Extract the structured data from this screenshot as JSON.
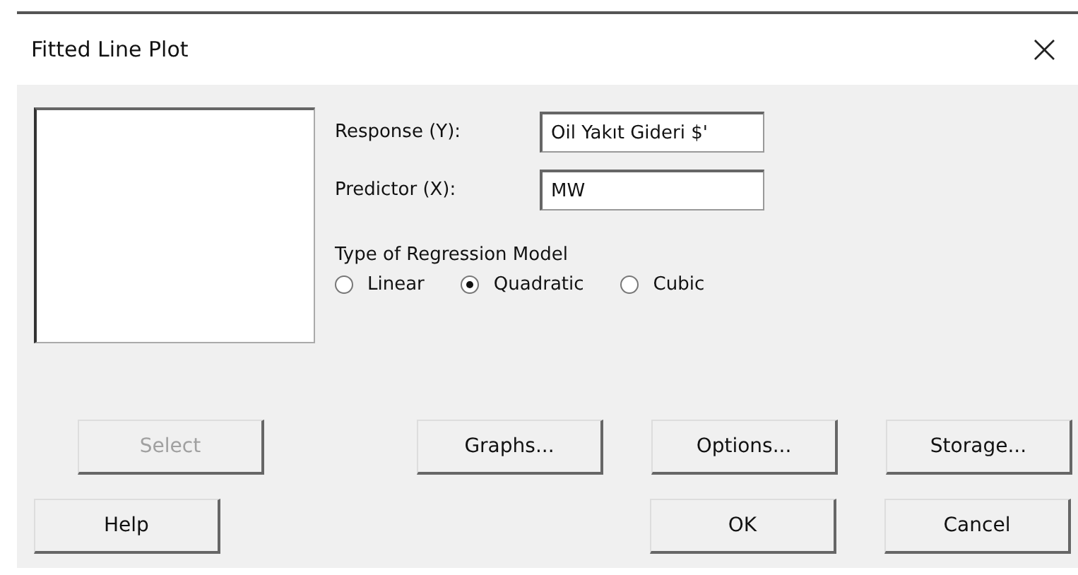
{
  "window": {
    "title": "Fitted Line Plot",
    "close": "×"
  },
  "fields": [
    {
      "label": "Response (Y):",
      "value": "Oil Yakıt Gideri $'"
    },
    {
      "label": "Predictor (X):",
      "value": "MW"
    }
  ],
  "model_group": {
    "label": "Type of Regression Model",
    "options": [
      {
        "label": "Linear",
        "selected": false
      },
      {
        "label": "Quadratic",
        "selected": true
      },
      {
        "label": "Cubic",
        "selected": false
      }
    ]
  },
  "buttons_row_1": [
    {
      "label": "Select",
      "disabled": true,
      "kind": "left"
    },
    {
      "label": "Graphs...",
      "disabled": false,
      "kind": "right"
    },
    {
      "label": "Options...",
      "disabled": false,
      "kind": "right"
    },
    {
      "label": "Storage...",
      "disabled": false,
      "kind": "right"
    }
  ],
  "buttons_row_2": [
    {
      "label": "Help",
      "disabled": false,
      "kind": "left"
    },
    {
      "label": "OK",
      "disabled": false,
      "kind": "right"
    },
    {
      "label": "Cancel",
      "disabled": false,
      "kind": "right"
    }
  ]
}
